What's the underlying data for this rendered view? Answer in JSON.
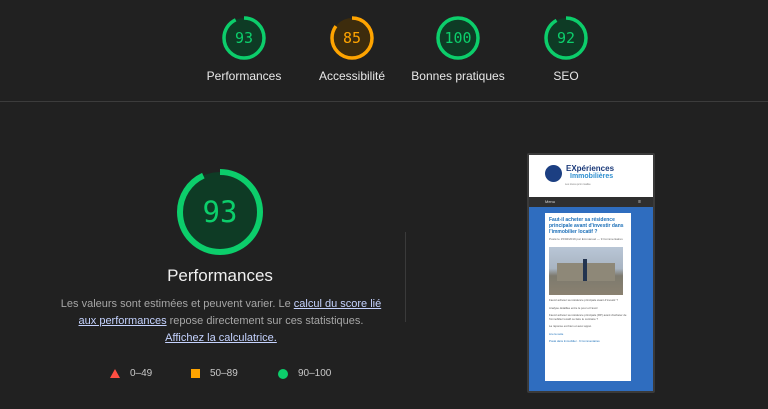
{
  "summary": {
    "gauges": [
      {
        "label": "Performances",
        "score": "93",
        "value": 93,
        "color": "#0cce6b",
        "bg": "#0e3b25"
      },
      {
        "label": "Accessibilité",
        "score": "85",
        "value": 85,
        "color": "#ffa400",
        "bg": "#3d2c0d"
      },
      {
        "label": "Bonnes pratiques",
        "score": "100",
        "value": 100,
        "color": "#0cce6b",
        "bg": "#0e3b25"
      },
      {
        "label": "SEO",
        "score": "92",
        "value": 92,
        "color": "#0cce6b",
        "bg": "#0e3b25"
      }
    ]
  },
  "detail": {
    "score": "93",
    "value": 93,
    "title": "Performances",
    "desc_part1": "Les valeurs sont estimées et peuvent varier. Le ",
    "link1": "calcul du score lié aux performances",
    "desc_part2": " repose directement sur ces statistiques. ",
    "link2": "Affichez la calculatrice."
  },
  "legend": {
    "fail": "0–49",
    "average": "50–89",
    "pass": "90–100",
    "colors": {
      "fail": "#ff4e42",
      "average": "#ffa400",
      "pass": "#0cce6b"
    }
  },
  "screenshot": {
    "logo_line1": "EXpériences",
    "logo_line2": "Immobilières",
    "tagline": "Les rêves qu'on réalise",
    "menu": "Menu",
    "menu_icon": "≡",
    "post_title": "Faut-il acheter sa résidence principale avant d'investir dans l'immobilier locatif ?",
    "post_meta": "Posté le 15/02/2019 par Emmanuel — 9 Commentaires",
    "text1": "Faut-il acheter sa résidence principale avant d'investir ?",
    "text2": "Analyse détaillée entre le pour et l'avoir",
    "text3": "Faut-il acheter sa résidence principale (RP) avant d'acheter de l'immobilier locatif ou faire le contraire ?",
    "text4": "La réponse est bien et avec appui.",
    "read_more": "Lire la suite",
    "footer": "Posté dans Immobilier · 9 Commentaires"
  }
}
